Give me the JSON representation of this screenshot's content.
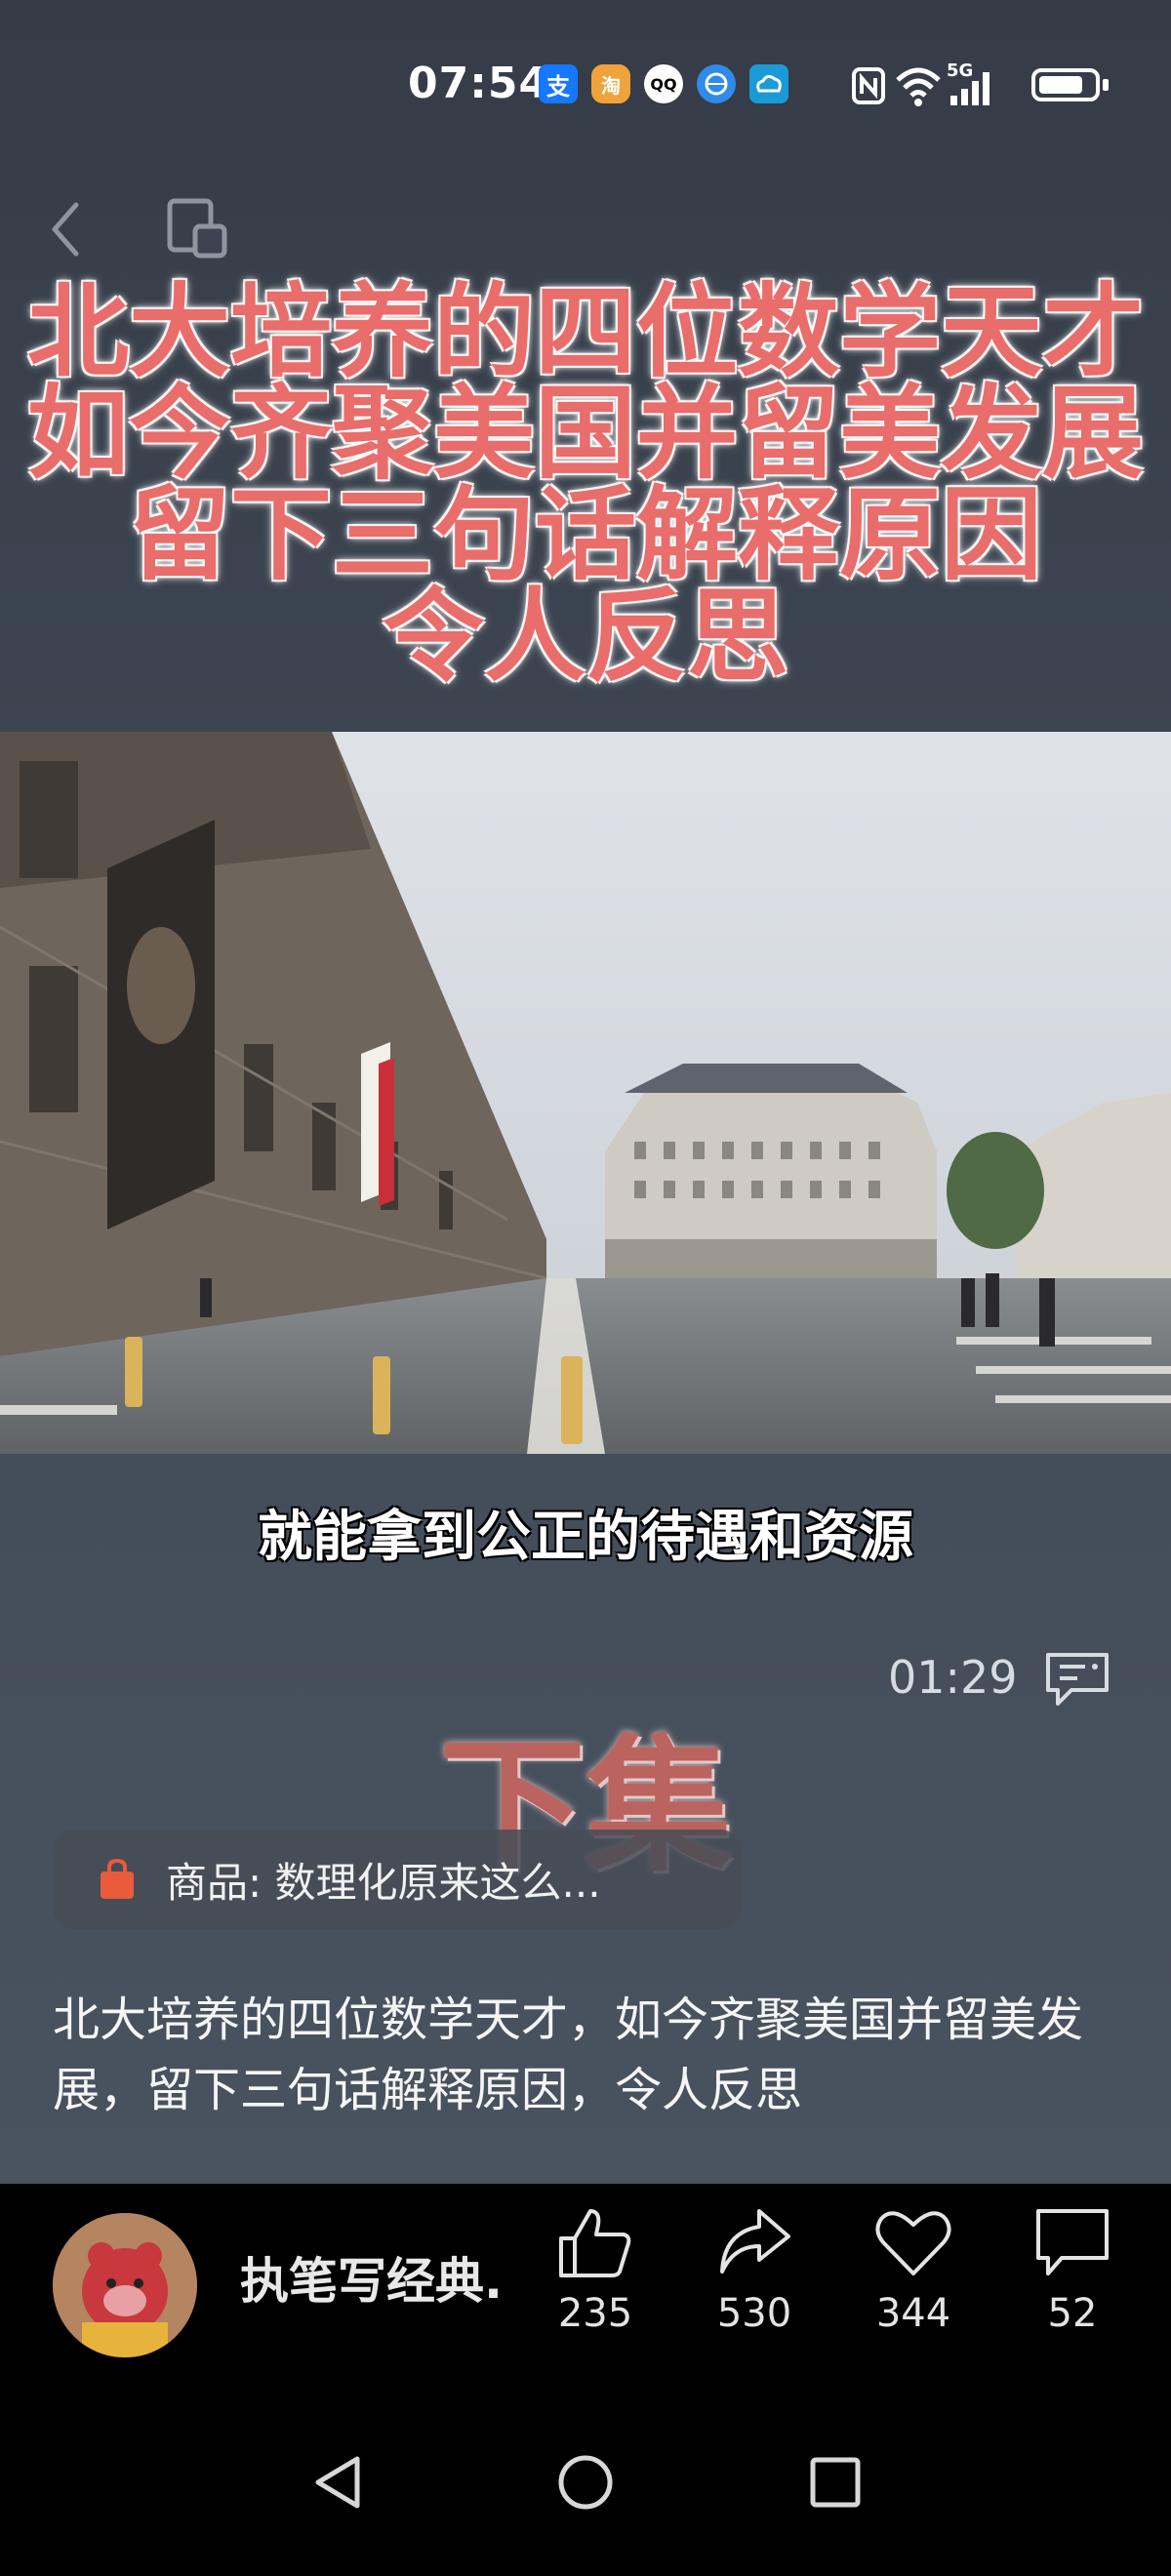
{
  "status_bar": {
    "time": "07:54",
    "apps": [
      "支",
      "淘",
      "QQ",
      "browser",
      "cloud"
    ],
    "signal_label": "5G",
    "icons": [
      "nfc-icon",
      "wifi-icon",
      "signal-icon",
      "battery-icon"
    ]
  },
  "post": {
    "title_lines": [
      "北大培养的四位数学天才",
      "如今齐聚美国并留美发展",
      "留下三句话解释原因",
      "令人反思"
    ],
    "subtitle": "就能拿到公正的待遇和资源",
    "timer": "01:29",
    "overlay_text": "下集",
    "product_label": "商品: 数理化原来这么...",
    "description": "北大培养的四位数学天才，如今齐聚美国并留美发展，留下三句话解释原因，令人反思"
  },
  "author": {
    "name": "执笔写经典."
  },
  "actions": {
    "like_count": "235",
    "share_count": "530",
    "favorite_count": "344",
    "comment_count": "52"
  },
  "colors": {
    "title_red": "#e86d6b",
    "background": "#3b4450",
    "product_bag": "#ea5a3c"
  }
}
